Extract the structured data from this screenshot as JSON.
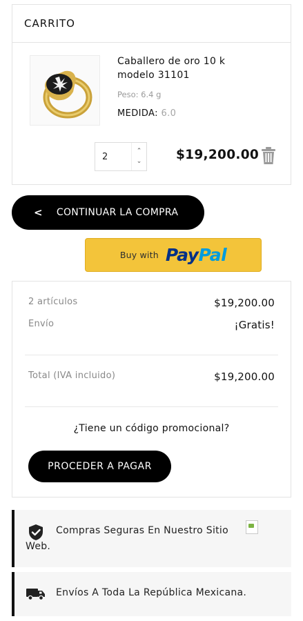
{
  "cart": {
    "title": "CARRITO",
    "item": {
      "name": "Caballero de oro 10 k modelo 31101",
      "weight": "Peso: 6.4 g",
      "size_label": "MEDIDA:",
      "size_value": "6.0",
      "quantity": "2",
      "price": "$19,200.00"
    }
  },
  "continue_label": "CONTINUAR LA COMPRA",
  "paypal": {
    "prefix": "Buy with",
    "brand_pay": "Pay",
    "brand_pal": "Pal"
  },
  "summary": {
    "items_label": "2 artículos",
    "items_value": "$19,200.00",
    "shipping_label": "Envío",
    "shipping_value": "¡Gratis!",
    "total_label": "Total (IVA incluido)",
    "total_value": "$19,200.00",
    "promo_label": "¿Tiene un código promocional?",
    "checkout_label": "PROCEDER A PAGAR"
  },
  "info": {
    "secure_line1": "Compras Seguras En Nuestro Sitio",
    "secure_line2": "Web.",
    "shipping": "Envíos A Toda La República Mexicana."
  },
  "icons": {
    "chevron": "chevron-left-icon",
    "trash": "trash-icon",
    "shield": "shield-check-icon",
    "truck": "truck-icon"
  },
  "colors": {
    "primary_button": "#000000",
    "paypal_yellow": "#f3c43a",
    "paypal_dark_blue": "#003087",
    "paypal_light_blue": "#009cde",
    "info_background": "#f6f6f6"
  }
}
